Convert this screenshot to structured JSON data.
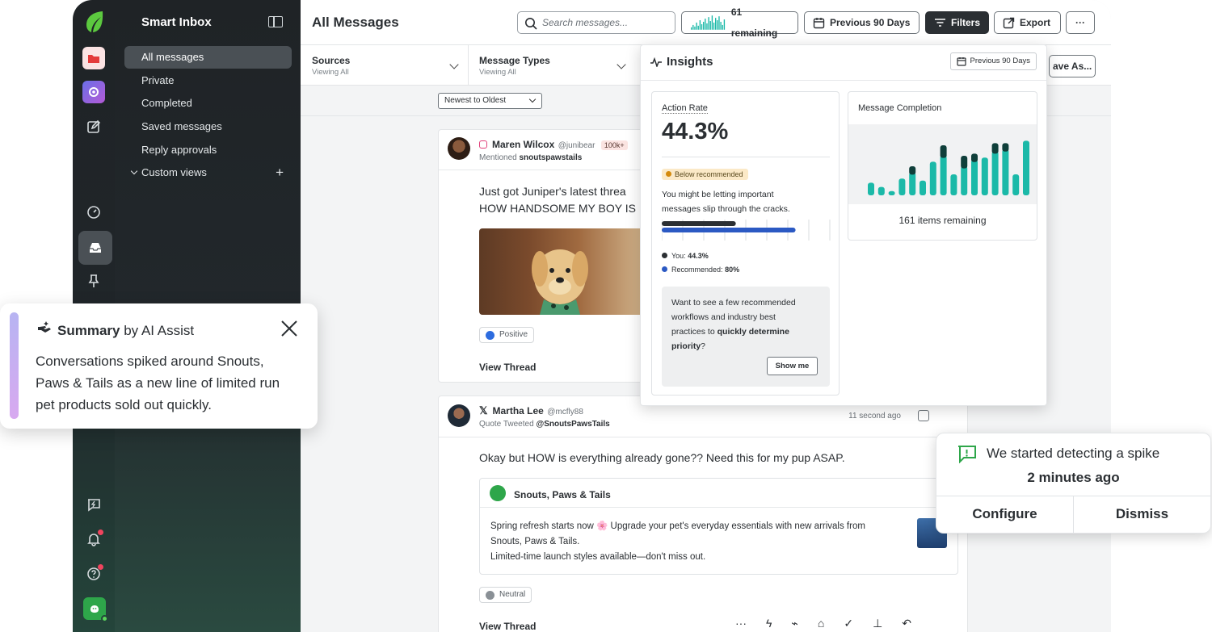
{
  "sidebar": {
    "title": "Smart Inbox",
    "items": [
      {
        "label": "All messages",
        "active": true
      },
      {
        "label": "Private"
      },
      {
        "label": "Completed"
      },
      {
        "label": "Saved messages"
      },
      {
        "label": "Reply approvals"
      },
      {
        "label": "Custom views"
      }
    ]
  },
  "header": {
    "title": "All Messages",
    "search_placeholder": "Search messages...",
    "remaining": "61 remaining",
    "date_range": "Previous 90 Days",
    "filters": "Filters",
    "export": "Export",
    "more": "···"
  },
  "filters": {
    "sources_label": "Sources",
    "sources_value": "Viewing All",
    "types_label": "Message Types",
    "types_value": "Viewing All",
    "save_as": "ave As..."
  },
  "sort": {
    "value": "Newest to Oldest"
  },
  "messages": [
    {
      "author": "Maren Wilcox",
      "handle": "@junibear",
      "badge": "100k+",
      "context_prefix": "Mentioned",
      "context_target": "snoutspawstails",
      "text_line1": "Just got Juniper's latest threa",
      "text_line2": "HOW HANDSOME MY BOY IS",
      "sentiment": "Positive",
      "view_thread": "View Thread"
    },
    {
      "author": "Martha Lee",
      "handle": "@mcfly88",
      "context_prefix": "Quote Tweeted",
      "context_target": "@SnoutsPawsTails",
      "timestamp": "11 second ago",
      "text": "Okay but HOW is everything already gone?? Need this for my pup ASAP.",
      "quote_brand": "Snouts, Paws & Tails",
      "quote_line1": "Spring refresh starts now 🌸 Upgrade your pet's everyday essentials with new arrivals from",
      "quote_line2": "Snouts, Paws & Tails.",
      "quote_line3": "Limited-time launch styles available—don't miss out.",
      "sentiment": "Neutral",
      "view_thread": "View Thread"
    }
  ],
  "insights": {
    "title": "Insights",
    "date_range": "Previous 90 Days",
    "action_rate_label": "Action Rate",
    "action_rate_value": "44.3%",
    "warning_badge": "Below recommended",
    "warning_text_1": "You might be letting important",
    "warning_text_2": "messages slip through the cracks.",
    "you_label": "You:",
    "you_value": "44.3%",
    "rec_label": "Recommended:",
    "rec_value": "80%",
    "you_fraction": 0.443,
    "rec_fraction": 0.8,
    "tip_1": "Want to see a few recommended",
    "tip_2": "workflows and industry best",
    "tip_3_pre": "practices to",
    "tip_3_bold": "quickly determine",
    "tip_4": "priority",
    "tip_4_suffix": "?",
    "show_me": "Show me",
    "completion_label": "Message Completion",
    "completion_remaining": "161 items remaining"
  },
  "summary": {
    "title_bold": "Summary",
    "title_rest": "by AI Assist",
    "text_1": "Conversations spiked around Snouts,",
    "text_2": "Paws & Tails as a new line of limited run",
    "text_3": "pet products sold out quickly."
  },
  "spike": {
    "text": "We started detecting a spike",
    "time": "2 minutes ago",
    "configure": "Configure",
    "dismiss": "Dismiss"
  },
  "colors": {
    "accent_teal": "#1bb9a8",
    "dark_teal": "#0f3f3a",
    "blue_bar": "#2b59c3",
    "brand_green": "#2ea64a",
    "notif_red": "#f0445e"
  }
}
